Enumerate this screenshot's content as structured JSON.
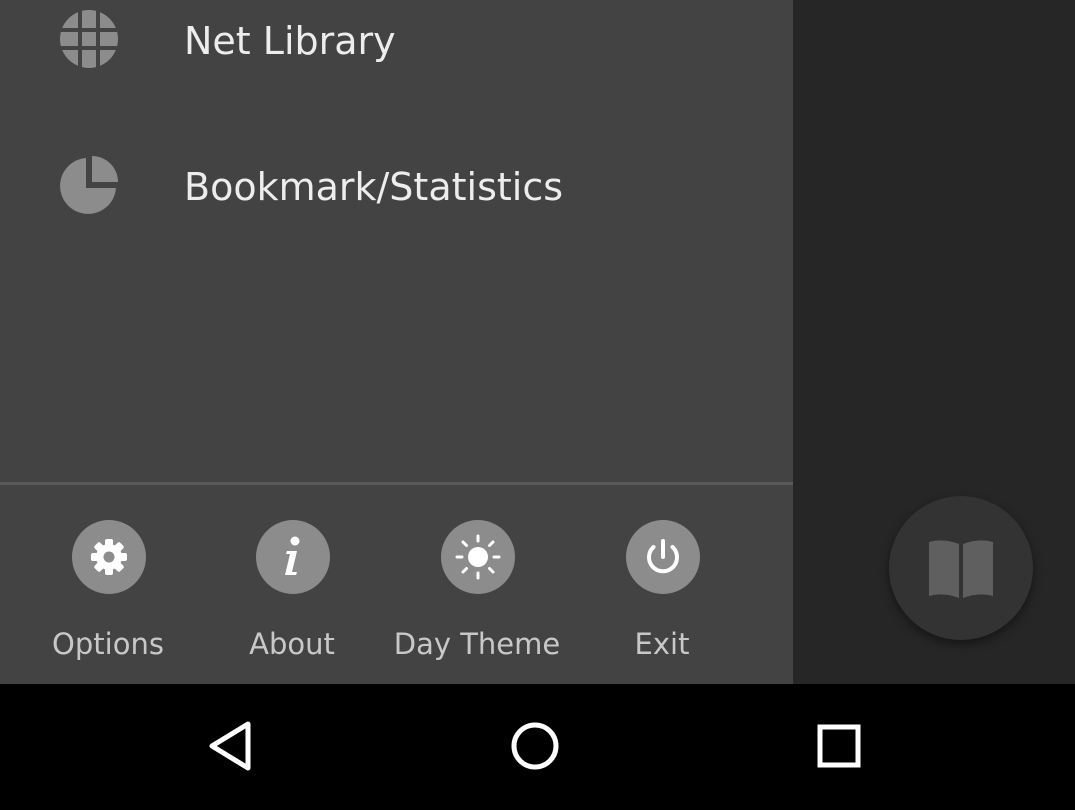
{
  "drawer": {
    "menu_items": [
      {
        "label": "Net Library",
        "icon": "globe-icon"
      },
      {
        "label": "Bookmark/Statistics",
        "icon": "pie-chart-icon"
      }
    ],
    "bottom_buttons": [
      {
        "label": "Options",
        "icon": "gear-icon"
      },
      {
        "label": "About",
        "icon": "info-icon"
      },
      {
        "label": "Day Theme",
        "icon": "sun-icon"
      },
      {
        "label": "Exit",
        "icon": "power-icon"
      }
    ]
  },
  "fab": {
    "icon": "open-book-icon"
  },
  "navbar": {
    "buttons": [
      {
        "icon": "back-triangle-icon"
      },
      {
        "icon": "home-circle-icon"
      },
      {
        "icon": "recents-square-icon"
      }
    ]
  },
  "colors": {
    "drawer_bg": "#434343",
    "screen_bg": "#262626",
    "icon_gray": "#8c8c8c",
    "text_light": "#ededed"
  }
}
